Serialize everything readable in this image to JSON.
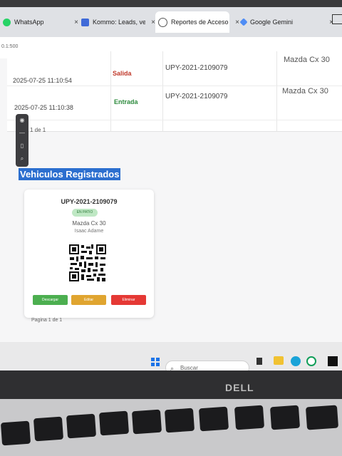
{
  "browser": {
    "tabs": [
      {
        "label": "WhatsApp",
        "close": "×"
      },
      {
        "label": "Kommo: Leads, ventas",
        "close": "×"
      },
      {
        "label": "Reportes de Acceso",
        "close": "×"
      },
      {
        "label": "Google Gemini",
        "close": "×"
      }
    ],
    "url_fragment": "0.1:500"
  },
  "table": {
    "rows": [
      {
        "datetime": "2025-07-25 11:10:54",
        "type": "Salida",
        "plate": "UPY-2021-2109079",
        "model": "Mazda Cx 30"
      },
      {
        "datetime": "2025-07-25 11:10:38",
        "type": "Entrada",
        "plate": "UPY-2021-2109079",
        "model": "Mazda Cx 30"
      }
    ],
    "pagination": "1 de 1"
  },
  "section": {
    "title": "Vehiculos Registrados"
  },
  "card": {
    "plate": "UPY-2021-2109079",
    "status": "EN PATIO",
    "model": "Mazda Cx 30",
    "owner": "Isaac Adame",
    "buttons": {
      "download": "Descargar",
      "edit": "Editar",
      "delete": "Eliminar"
    }
  },
  "pagination_bottom": "Pagina 1 de 1",
  "taskbar": {
    "search_placeholder": "Buscar"
  },
  "laptop": {
    "brand": "DELL"
  },
  "colors": {
    "salida": "#c0392b",
    "entrada": "#2e8b3e",
    "download_button": "#4caf50",
    "edit_button": "#e0a530",
    "delete_button": "#e53935",
    "selection": "#2c6fcf"
  }
}
